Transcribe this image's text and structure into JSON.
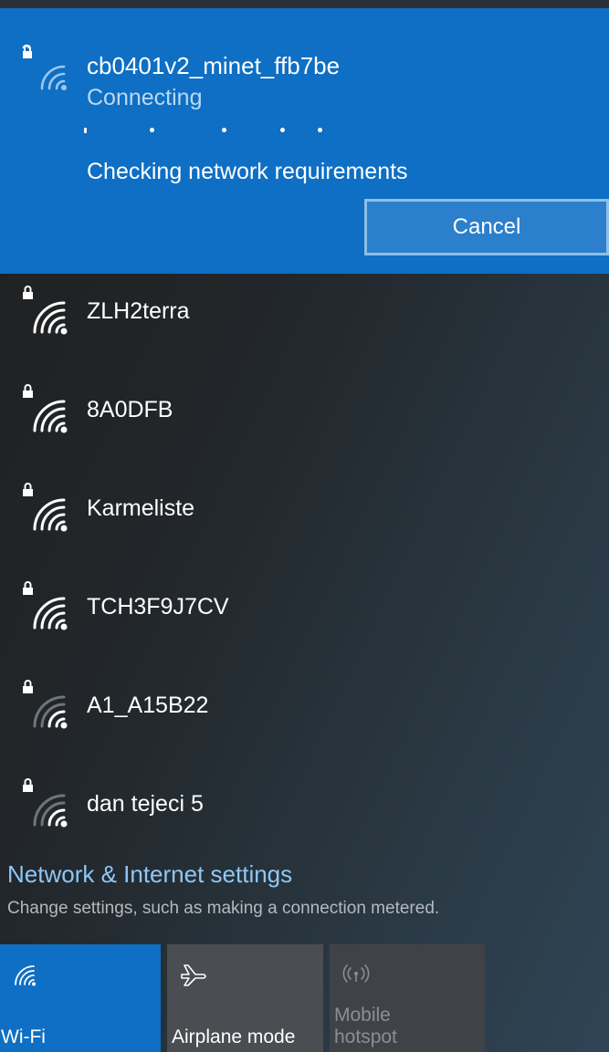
{
  "active_network": {
    "ssid": "cb0401v2_minet_ffb7be",
    "status": "Connecting",
    "detail": "Checking network requirements",
    "cancel_label": "Cancel"
  },
  "networks": [
    {
      "ssid": "ZLH2terra",
      "icon": "wifi-secured-icon"
    },
    {
      "ssid": "8A0DFB",
      "icon": "wifi-secured-icon"
    },
    {
      "ssid": "Karmeliste",
      "icon": "wifi-secured-icon"
    },
    {
      "ssid": "TCH3F9J7CV",
      "icon": "wifi-secured-icon"
    },
    {
      "ssid": "A1_A15B22",
      "icon": "wifi-secured-icon"
    },
    {
      "ssid": "dan tejeci 5",
      "icon": "wifi-secured-icon"
    }
  ],
  "settings": {
    "link": "Network & Internet settings",
    "description": "Change settings, such as making a connection metered."
  },
  "quick_actions": {
    "wifi_label": "Wi-Fi",
    "airplane_label": "Airplane mode",
    "hotspot_label_line1": "Mobile",
    "hotspot_label_line2": "hotspot"
  },
  "colors": {
    "accent": "#0e6fc4",
    "link": "#8ec7f6"
  }
}
